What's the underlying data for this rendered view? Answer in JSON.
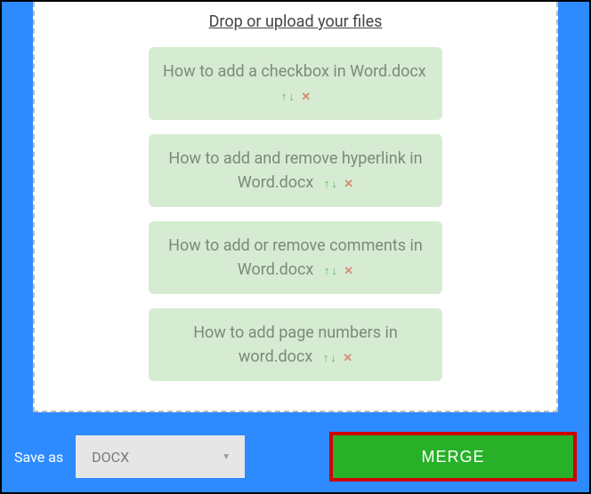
{
  "upload": {
    "prompt_text": "Drop or upload your files"
  },
  "files": [
    {
      "name": "How to add a checkbox in Word.docx"
    },
    {
      "name": "How to add and remove hyperlink in Word.docx"
    },
    {
      "name": "How to add or remove comments in Word.docx"
    },
    {
      "name": "How to add page numbers in word.docx"
    }
  ],
  "footer": {
    "save_as_label": "Save as",
    "format_value": "DOCX",
    "merge_label": "MERGE"
  },
  "icons": {
    "up": "↑",
    "down": "↓",
    "remove": "✕",
    "caret": "▼"
  }
}
